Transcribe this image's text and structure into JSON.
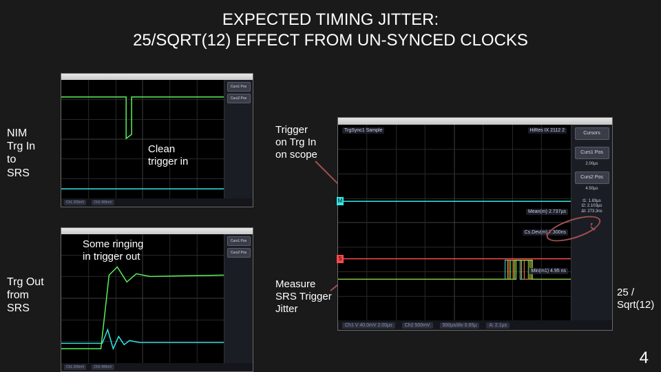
{
  "title_line1": "EXPECTED TIMING JITTER:",
  "title_line2": "25/SQRT(12) EFFECT FROM UN-SYNCED CLOCKS",
  "labels": {
    "nim_in": "NIM\nTrg In\nto\nSRS",
    "trg_out": "Trg Out\nfrom\nSRS",
    "clean": "Clean\ntrigger in",
    "ringing": "Some ringing\nin trigger out",
    "trig_on": "Trigger\non Trg In\non scope",
    "measure": "Measure\nSRS Trigger\nJitter",
    "formula": "25 /\nSqrt(12)"
  },
  "page_number": "4",
  "scope_small": {
    "sidebar_btn1": "Curs1 Pos",
    "sidebar_btn2": "Curs2 Pos",
    "footer_ch1": "Ch1  200mV",
    "footer_ch2": "Ch2  400mV"
  },
  "scope_big": {
    "sidebar_cursors": "Cursors",
    "sidebar_c1": "Curs1 Pos",
    "sidebar_c1v": "2.00µs",
    "sidebar_c2": "Curs2 Pos",
    "sidebar_c2v": "4.50µs",
    "sidebar_stats": "t1: 1.83µs\nt2: 2.103µs\nΔt: 273.3ns",
    "tag_trg": "TrgSync1  Sample",
    "tag_info": "HiRes IX  2112 2",
    "plot_mean": "Mean(m)  2.737µs",
    "plot_sd": "Cs.Dev(m)  7.300ns",
    "plot_min": "Min(m1)  4.95 ns",
    "footer_ch1": "Ch1  V 40.0mV 2.00µs",
    "footer_ch2": "Ch2  500mV",
    "footer_time": "500µs/div 0.65µ",
    "footer_rate": "A: 2.1µs"
  }
}
